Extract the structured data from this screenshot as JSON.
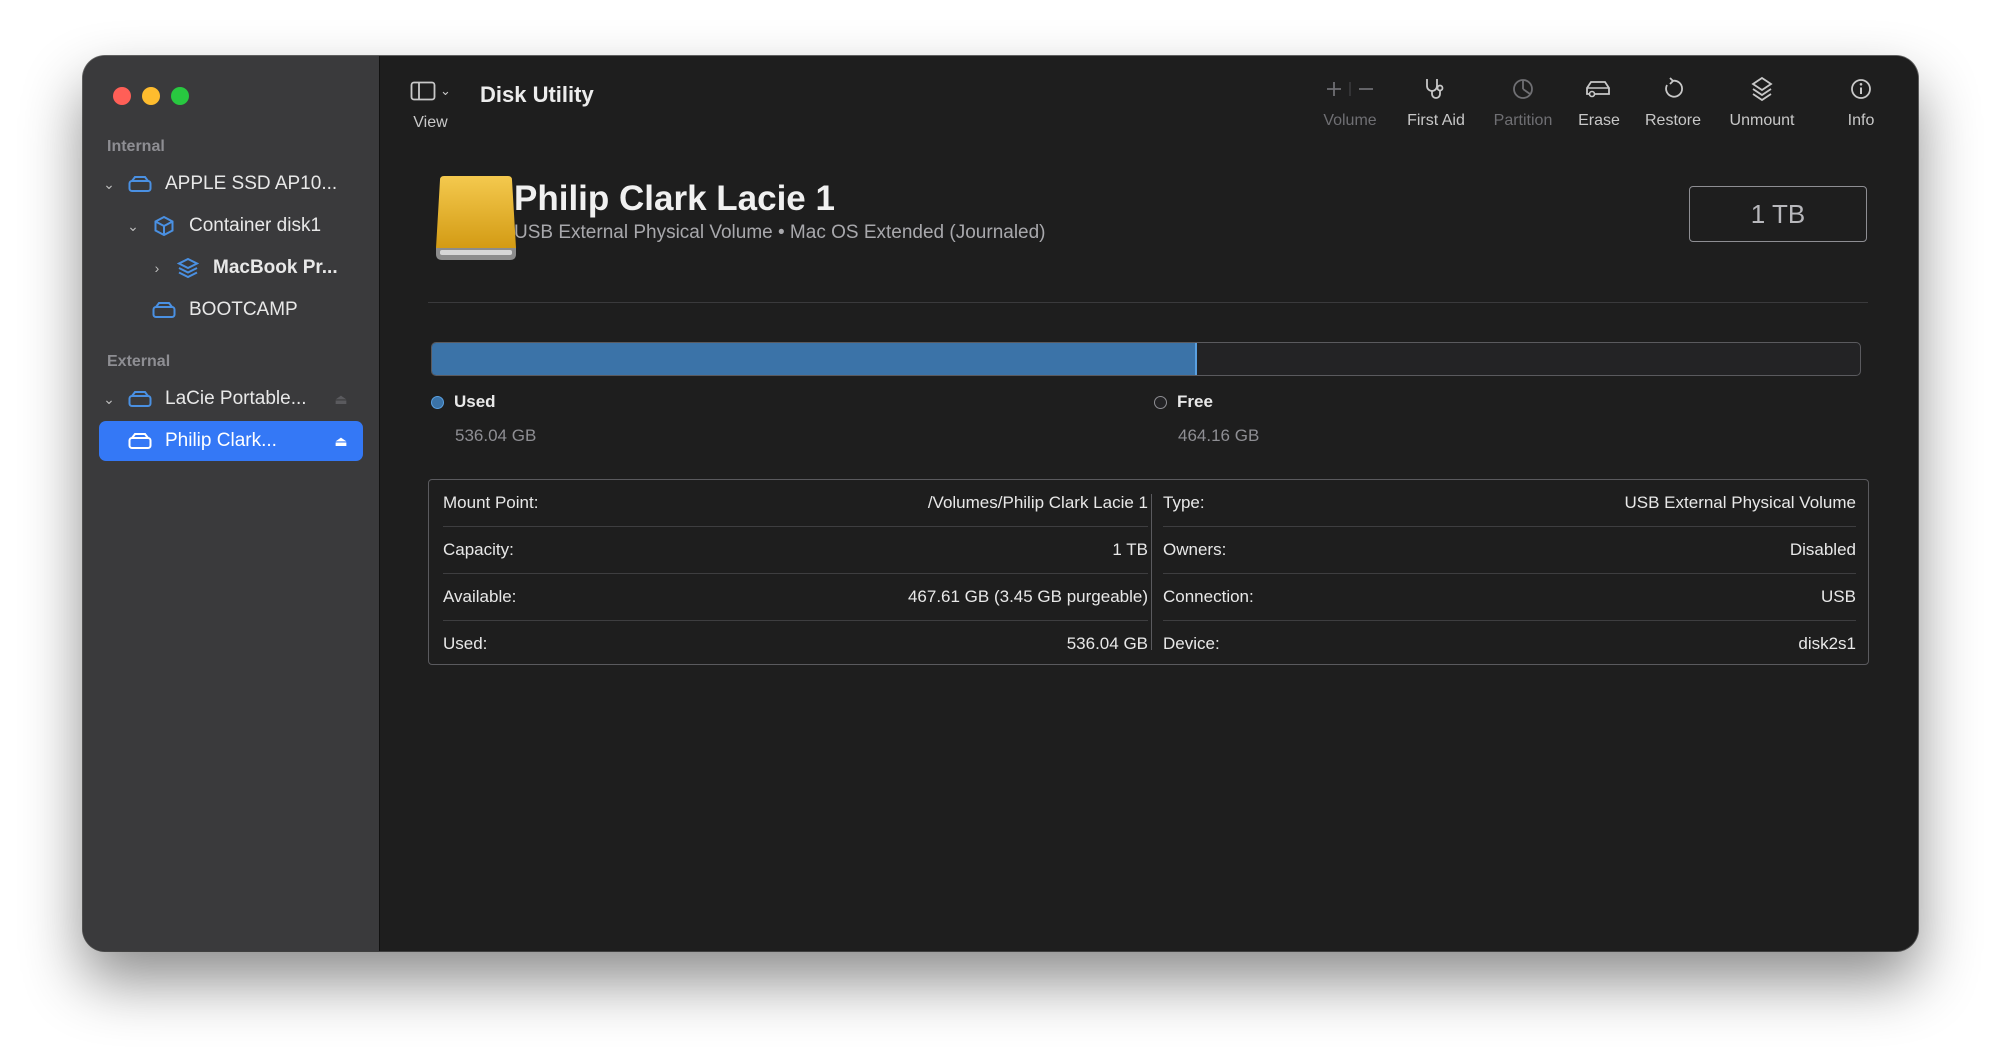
{
  "window": {
    "app_title": "Disk Utility"
  },
  "sidebar": {
    "sections": [
      {
        "label": "Internal"
      },
      {
        "label": "External"
      }
    ],
    "items": [
      {
        "label": "APPLE SSD AP10..."
      },
      {
        "label": "Container disk1"
      },
      {
        "label": "MacBook Pr..."
      },
      {
        "label": "BOOTCAMP"
      },
      {
        "label": "LaCie Portable..."
      },
      {
        "label": "Philip Clark..."
      }
    ]
  },
  "toolbar": {
    "view_label": "View",
    "volume_label": "Volume",
    "first_aid_label": "First Aid",
    "partition_label": "Partition",
    "erase_label": "Erase",
    "restore_label": "Restore",
    "unmount_label": "Unmount",
    "info_label": "Info"
  },
  "volume": {
    "name": "Philip Clark Lacie 1",
    "subtitle": "USB External Physical Volume • Mac OS Extended (Journaled)",
    "capacity_badge": "1 TB",
    "used_fraction": 0.536
  },
  "legend": {
    "used_label": "Used",
    "used_value": "536.04 GB",
    "free_label": "Free",
    "free_value": "464.16 GB"
  },
  "info": {
    "left": [
      {
        "key": "Mount Point:",
        "value": "/Volumes/Philip Clark Lacie 1"
      },
      {
        "key": "Capacity:",
        "value": "1 TB"
      },
      {
        "key": "Available:",
        "value": "467.61 GB (3.45 GB purgeable)"
      },
      {
        "key": "Used:",
        "value": "536.04 GB"
      }
    ],
    "right": [
      {
        "key": "Type:",
        "value": "USB External Physical Volume"
      },
      {
        "key": "Owners:",
        "value": "Disabled"
      },
      {
        "key": "Connection:",
        "value": "USB"
      },
      {
        "key": "Device:",
        "value": "disk2s1"
      }
    ]
  },
  "colors": {
    "accent": "#3478f6",
    "used_bar": "#3b73a8",
    "sidebar_icon": "#4a90e2"
  },
  "icons": [
    "sidebar-toggle-icon",
    "chevron-down-icon",
    "plus-icon",
    "minus-icon",
    "stethoscope-icon",
    "pie-chart-icon",
    "eraser-car-icon",
    "restore-arrow-icon",
    "eject-stack-icon",
    "info-circle-icon",
    "drive-icon",
    "container-cube-icon",
    "volume-stack-icon",
    "eject-icon",
    "external-drive-icon"
  ]
}
